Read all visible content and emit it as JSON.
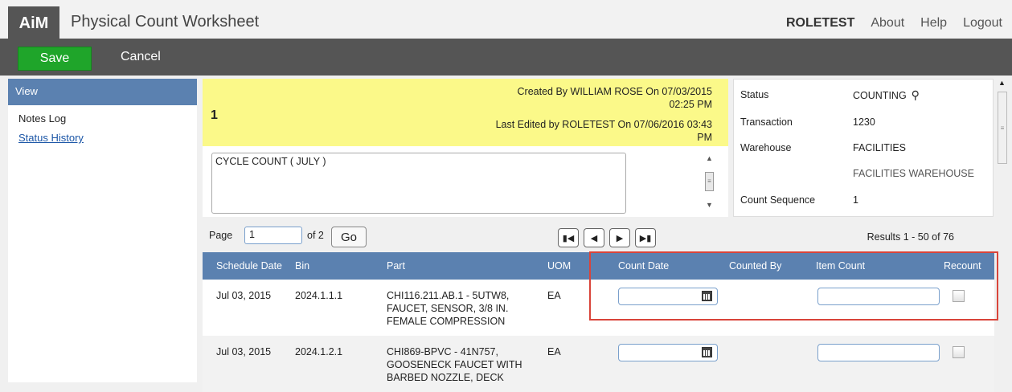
{
  "header": {
    "logo": "AiM",
    "title": "Physical Count Worksheet",
    "user": "ROLETEST",
    "links": [
      "About",
      "Help",
      "Logout"
    ]
  },
  "toolbar": {
    "save": "Save",
    "cancel": "Cancel"
  },
  "sidebar": {
    "heading": "View",
    "items": [
      "Notes Log"
    ],
    "links": [
      "Status History"
    ]
  },
  "record": {
    "number": "1",
    "created_line1": "Created By WILLIAM ROSE On 07/03/2015",
    "created_line2": "02:25 PM",
    "edited_line1": "Last Edited by ROLETEST On 07/06/2016 03:43",
    "edited_line2": "PM",
    "description": "CYCLE COUNT ( JULY )"
  },
  "details": {
    "status_label": "Status",
    "status_value": "COUNTING",
    "transaction_label": "Transaction",
    "transaction_value": "1230",
    "warehouse_label": "Warehouse",
    "warehouse_value": "FACILITIES",
    "warehouse_desc": "FACILITIES WAREHOUSE",
    "seq_label": "Count Sequence",
    "seq_value": "1"
  },
  "pager": {
    "page_label": "Page",
    "page_value": "1",
    "of_label": "of 2",
    "go": "Go",
    "results": "Results 1 - 50 of 76"
  },
  "table": {
    "columns": [
      "Schedule Date",
      "Bin",
      "Part",
      "UOM",
      "Count Date",
      "Counted By",
      "Item Count",
      "Recount"
    ],
    "rows": [
      {
        "date": "Jul 03, 2015",
        "bin": "2024.1.1.1",
        "part1": "CHI116.211.AB.1 - 5UTW8,",
        "part2": "FAUCET, SENSOR, 3/8 IN.",
        "part3": "FEMALE COMPRESSION",
        "uom": "EA"
      },
      {
        "date": "Jul 03, 2015",
        "bin": "2024.1.2.1",
        "part1": "CHI869-BPVC - 41N757,",
        "part2": "GOOSENECK FAUCET WITH",
        "part3": "BARBED NOZZLE, DECK",
        "uom": "EA"
      }
    ]
  },
  "colors": {
    "toolbar": "#555555",
    "save": "#1fa52a",
    "header_blue": "#5b81b0",
    "yellow": "#fbf989",
    "highlight": "#d9443a"
  }
}
